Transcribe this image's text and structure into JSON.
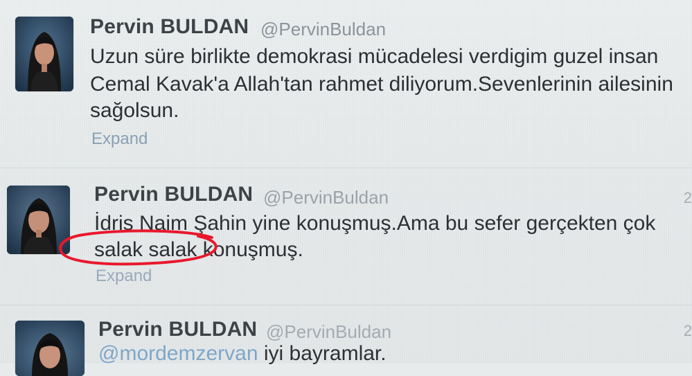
{
  "timeline": {
    "tweets": [
      {
        "author_name": "Pervin BULDAN",
        "author_handle": "@PervinBuldan",
        "text_lines": [
          "Uzun süre birlikte demokrasi mücadelesi verdigim guzel insan",
          "Cemal Kavak'a Allah'tan rahmet diliyorum.Sevenlerinin ailesinin",
          "sağolsun."
        ],
        "expand_label": "Expand",
        "time": ""
      },
      {
        "author_name": "Pervin BULDAN",
        "author_handle": "@PervinBuldan",
        "text_lines": [
          "İdris Naim Şahin yine konuşmuş.Ama bu sefer gerçekten çok",
          "salak salak konuşmuş."
        ],
        "expand_label": "Expand",
        "time": "2"
      },
      {
        "author_name": "Pervin BULDAN",
        "author_handle": "@PervinBuldan",
        "mention": "@mordemzervan",
        "text_after_mention": " iyi bayramlar.",
        "time": "2"
      }
    ]
  },
  "colors": {
    "background": "#e7ebec",
    "name_text": "#3c4346",
    "body_text": "#2c2f33",
    "handle_text": "#8b949b",
    "link_blue": "#7fa6c8",
    "highlight_red": "#e8182c"
  },
  "icons": {
    "avatar": "profile-photo"
  }
}
